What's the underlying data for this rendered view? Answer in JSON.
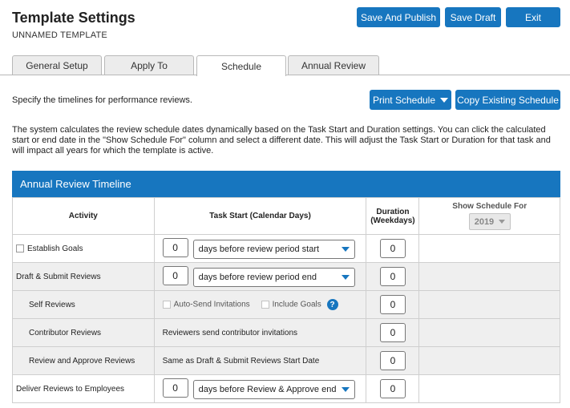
{
  "header": {
    "title": "Template Settings",
    "subtitle": "UNNAMED TEMPLATE",
    "save_publish_label": "Save And Publish",
    "save_draft_label": "Save Draft",
    "exit_label": "Exit"
  },
  "tabs": [
    {
      "label": "General Setup"
    },
    {
      "label": "Apply To"
    },
    {
      "label": "Schedule",
      "active": true
    },
    {
      "label": "Annual Review"
    }
  ],
  "intro_text": "Specify the timelines for performance reviews.",
  "print_schedule_label": "Print Schedule",
  "copy_schedule_label": "Copy Existing Schedule",
  "description": "The system calculates the review schedule dates dynamically based on the Task Start and Duration settings. You can click the calculated start or end date in the \"Show Schedule For\" column and select a different date. This will adjust the Task Start or Duration for that task and will impact all years for which the template is active.",
  "panel_title": "Annual Review Timeline",
  "columns": {
    "activity": "Activity",
    "task_start": "Task Start (Calendar Days)",
    "duration": "Duration (Weekdays)",
    "show_schedule": "Show Schedule For",
    "year": "2019"
  },
  "rows": [
    {
      "activity": "Establish Goals",
      "start_days": "0",
      "start_ref": "days before review period start",
      "duration": "0"
    },
    {
      "activity": "Draft & Submit Reviews",
      "start_days": "0",
      "start_ref": "days before review period end",
      "duration": "0"
    },
    {
      "activity": "Self Reviews",
      "auto_send": "Auto-Send Invitations",
      "include_goals": "Include Goals",
      "duration": "0"
    },
    {
      "activity": "Contributor Reviews",
      "note": "Reviewers send contributor invitations",
      "duration": "0"
    },
    {
      "activity": "Review and Approve Reviews",
      "note": "Same as Draft & Submit Reviews Start Date",
      "duration": "0"
    },
    {
      "activity": "Deliver Reviews to Employees",
      "start_days": "0",
      "start_ref": "days before Review & Approve end",
      "duration": "0"
    }
  ],
  "colors": {
    "accent": "#1776bf",
    "row_shade": "#efefef"
  }
}
